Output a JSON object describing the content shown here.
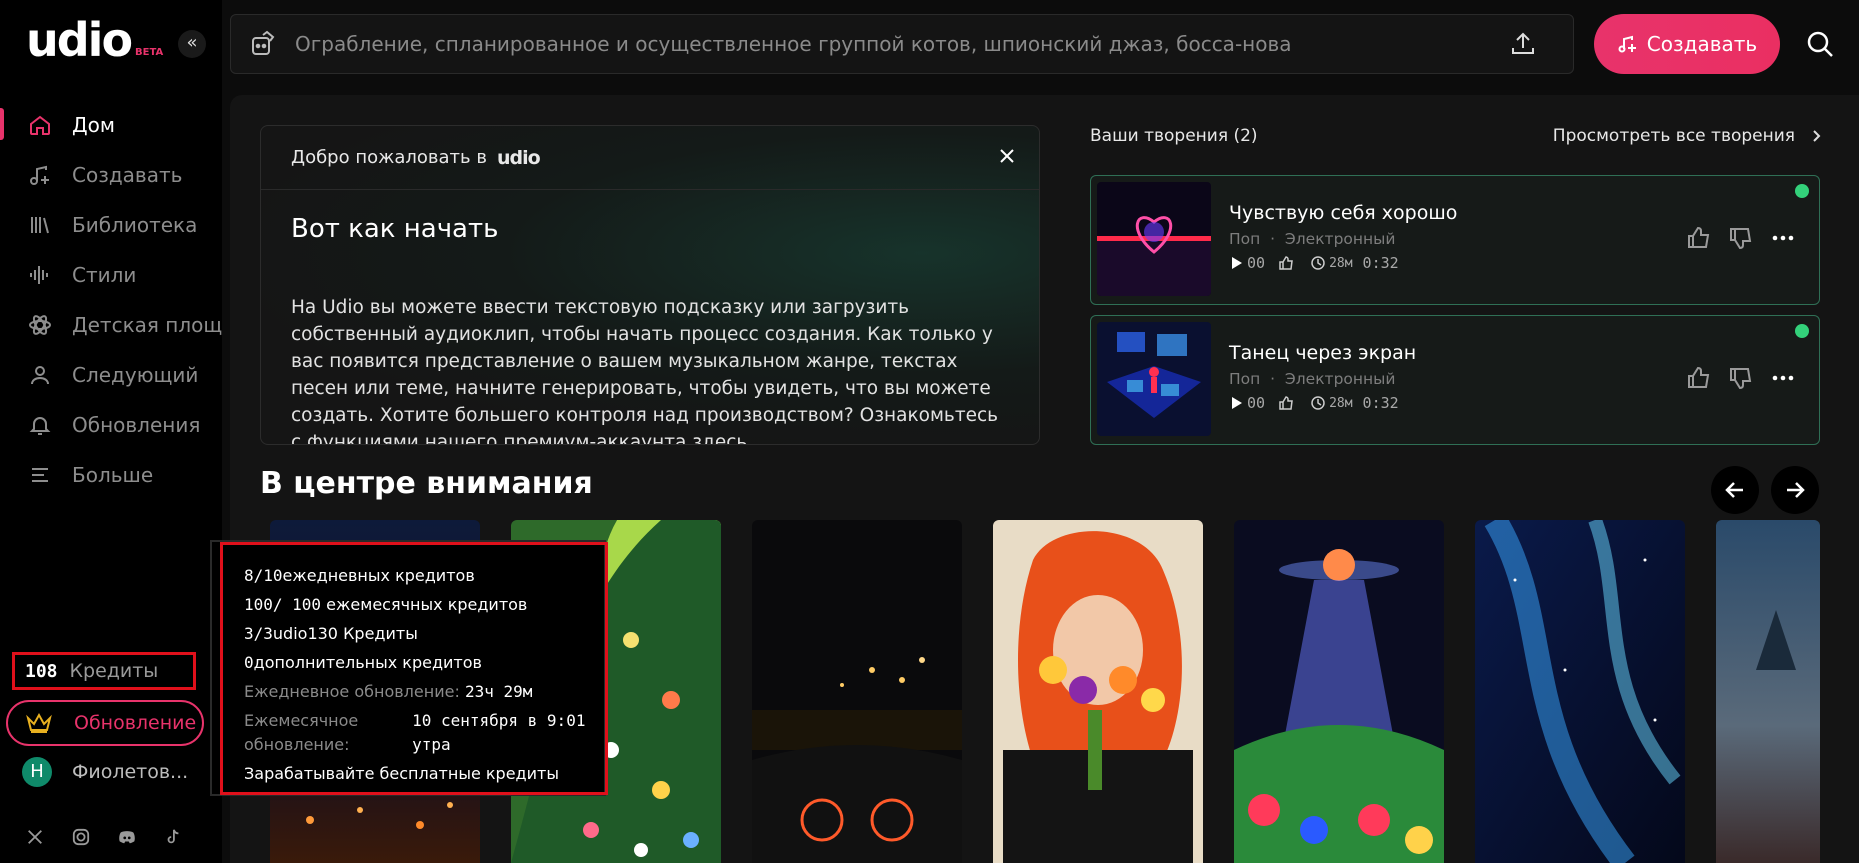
{
  "logo": {
    "wordmark": "udio",
    "badge": "BETA"
  },
  "sidebar": {
    "items": [
      {
        "label": "Дом",
        "icon": "home-icon"
      },
      {
        "label": "Создавать",
        "icon": "music-create-icon"
      },
      {
        "label": "Библиотека",
        "icon": "library-icon"
      },
      {
        "label": "Стили",
        "icon": "waveform-icon"
      },
      {
        "label": "Детская площадка",
        "icon": "atom-icon"
      },
      {
        "label": "Следующий",
        "icon": "user-icon"
      },
      {
        "label": "Обновления",
        "icon": "bell-icon"
      },
      {
        "label": "Больше",
        "icon": "menu-icon"
      }
    ],
    "credits_count": "108",
    "credits_label": "Кредиты",
    "upgrade_label": "Обновление",
    "user_initial": "Н",
    "user_name": "Фиолетов..."
  },
  "search": {
    "placeholder": "Ограбление, спланированное и осуществленное группой котов, шпионский джаз, босса-нова"
  },
  "create_button": "Создавать",
  "welcome": {
    "heading_prefix": "Добро пожаловать в",
    "brand": "udio",
    "title": "Вот как начать",
    "body": "На Udio вы можете ввести текстовую подсказку или загрузить собственный аудиоклип, чтобы начать процесс создания. Как только у вас появится представление о вашем музыкальном жанре, текстах песен или теме, начните генерировать, чтобы увидеть, что вы можете создать. Хотите большего контроля над производством? Ознакомьтесь с функциями нашего премиум-аккаунта",
    "link": "здесь",
    "after_link": "."
  },
  "creations": {
    "title": "Ваши творения (2)",
    "see_all": "Просмотреть все творения",
    "tracks": [
      {
        "name": "Чувствую себя хорошо",
        "genre1": "Поп",
        "genre2": "Электронный",
        "plays": "00",
        "age": "28м",
        "duration": "0:32"
      },
      {
        "name": "Танец через экран",
        "genre1": "Поп",
        "genre2": "Электронный",
        "plays": "00",
        "age": "28м",
        "duration": "0:32"
      }
    ]
  },
  "spotlight": {
    "title": "В центре внимания"
  },
  "tooltip": {
    "daily": {
      "value": "8/10",
      "label": "ежедневных кредитов"
    },
    "monthly": {
      "value": "100/ 100",
      "label": " ежемесячных кредитов"
    },
    "udio130": {
      "value": "3/3",
      "label": "udio130 Кредиты"
    },
    "additional": {
      "value": "0",
      "label": "дополнительных кредитов"
    },
    "daily_refresh_label": "Ежедневное обновление:",
    "daily_refresh_value": "23ч 29м",
    "monthly_refresh_label": "Ежемесячное обновление:",
    "monthly_refresh_value": "10 сентября в 9:01 утра",
    "earn": "Зарабатывайте бесплатные кредиты"
  },
  "colors": {
    "accent": "#e8336b",
    "highlight": "#e0101b",
    "online": "#33d17a",
    "track_border": "#2f6f55"
  }
}
